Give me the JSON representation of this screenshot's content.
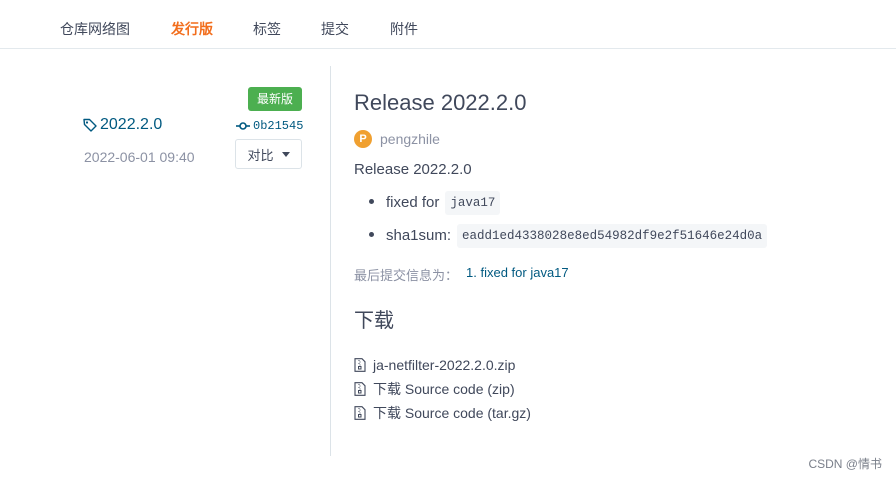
{
  "tabs": [
    {
      "label": "仓库网络图",
      "active": false
    },
    {
      "label": "发行版",
      "active": true
    },
    {
      "label": "标签",
      "active": false
    },
    {
      "label": "提交",
      "active": false
    },
    {
      "label": "附件",
      "active": false
    }
  ],
  "sidebar": {
    "latest_badge": "最新版",
    "tag_name": "2022.2.0",
    "commit_hash": "0b21545",
    "date": "2022-06-01 09:40",
    "compare_label": "对比"
  },
  "release": {
    "title": "Release 2022.2.0",
    "author_initial": "P",
    "author": "pengzhile",
    "description": "Release 2022.2.0",
    "bullets": [
      {
        "text": "fixed for",
        "code": "java17"
      },
      {
        "text": "sha1sum:",
        "code": "eadd1ed4338028e8ed54982df9e2f51646e24d0a"
      }
    ],
    "last_commit_label": "最后提交信息为：",
    "last_commit_message": "1. fixed for java17"
  },
  "downloads": {
    "title": "下载",
    "items": [
      "ja-netfilter-2022.2.0.zip",
      "下载 Source code (zip)",
      "下载 Source code (tar.gz)"
    ]
  },
  "watermark": "CSDN @情书",
  "colors": {
    "accent": "#f26e1d",
    "link": "#005980",
    "badge_green": "#4caf50",
    "avatar_orange": "#f0a030"
  }
}
